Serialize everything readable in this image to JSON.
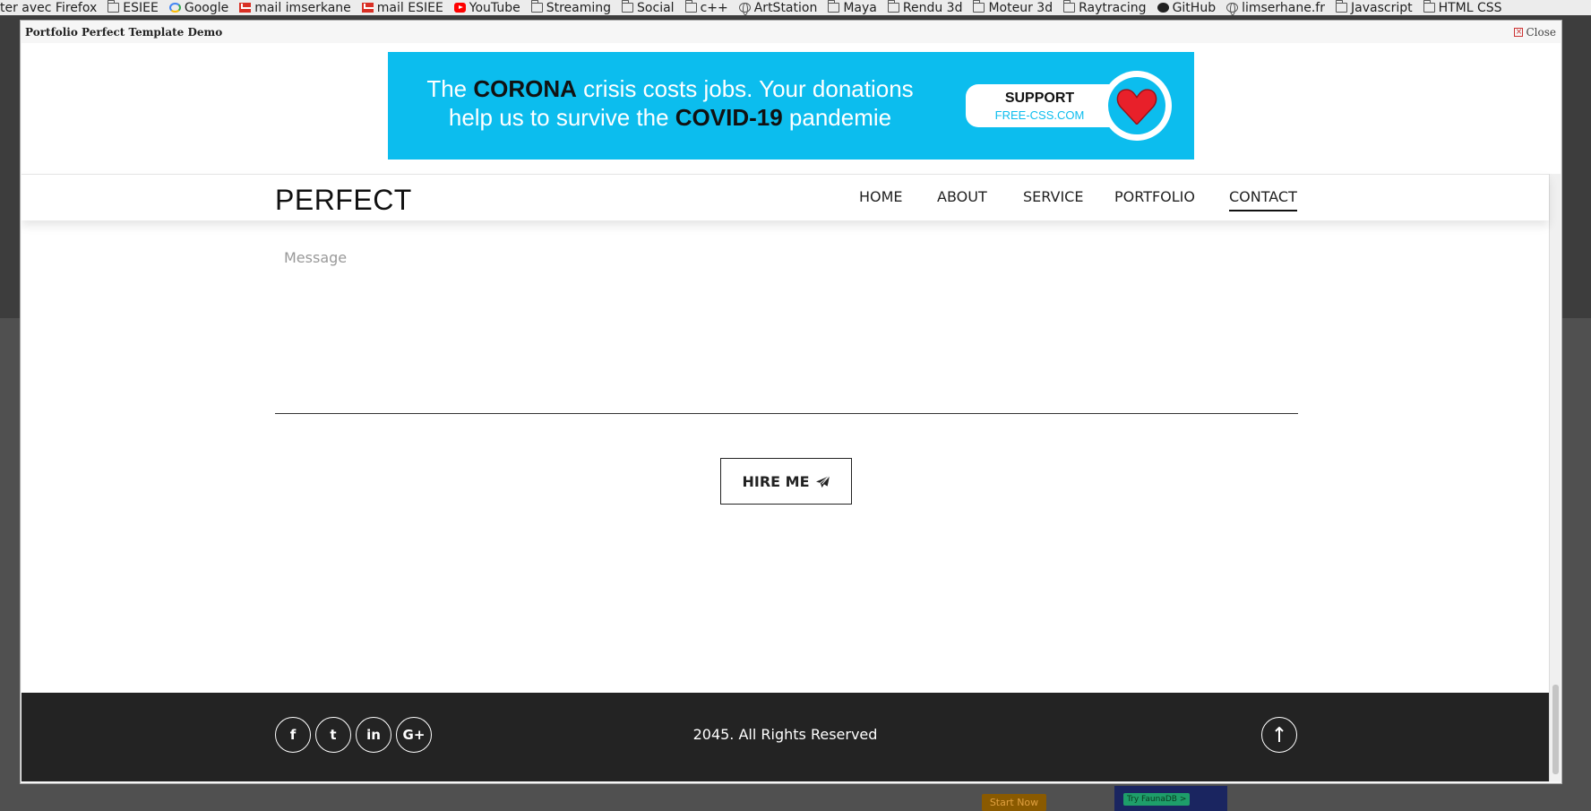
{
  "bookmarks": [
    {
      "label": "ter avec Firefox",
      "icon": "none"
    },
    {
      "label": "ESIEE",
      "icon": "folder-icon"
    },
    {
      "label": "Google",
      "icon": "google-icon"
    },
    {
      "label": "mail imserkane",
      "icon": "gmail-icon"
    },
    {
      "label": "mail ESIEE",
      "icon": "gmail-icon"
    },
    {
      "label": "YouTube",
      "icon": "youtube-icon"
    },
    {
      "label": "Streaming",
      "icon": "folder-icon"
    },
    {
      "label": "Social",
      "icon": "folder-icon"
    },
    {
      "label": "c++",
      "icon": "folder-icon"
    },
    {
      "label": "ArtStation",
      "icon": "globe-icon"
    },
    {
      "label": "Maya",
      "icon": "folder-icon"
    },
    {
      "label": "Rendu 3d",
      "icon": "folder-icon"
    },
    {
      "label": "Moteur 3d",
      "icon": "folder-icon"
    },
    {
      "label": "Raytracing",
      "icon": "folder-icon"
    },
    {
      "label": "GitHub",
      "icon": "github-icon"
    },
    {
      "label": "limserhane.fr",
      "icon": "globe-icon"
    },
    {
      "label": "Javascript",
      "icon": "folder-icon"
    },
    {
      "label": "HTML CSS",
      "icon": "folder-icon"
    }
  ],
  "modal": {
    "title": "Portfolio Perfect Template Demo",
    "close_label": "Close"
  },
  "banner": {
    "line1_pre": "The ",
    "line1_bold": "CORONA",
    "line1_post": " crisis costs jobs. Your donations",
    "line2_pre": "help us to survive the ",
    "line2_bold": "COVID-19",
    "line2_post": " pandemie",
    "support_title": "SUPPORT",
    "support_site": "FREE-CSS.COM",
    "colors": {
      "background": "#0cbdee",
      "heart": "#e8202a"
    }
  },
  "nav": {
    "logo": "PERFECT",
    "items": [
      "HOME",
      "ABOUT",
      "SERVICE",
      "PORTFOLIO",
      "CONTACT"
    ],
    "active": "CONTACT"
  },
  "form": {
    "message_placeholder": "Message",
    "message_value": "",
    "submit_label": "HIRE ME",
    "submit_icon": "paper-plane-icon"
  },
  "footer": {
    "social": [
      {
        "name": "facebook",
        "glyph": "f"
      },
      {
        "name": "twitter",
        "glyph": "t"
      },
      {
        "name": "linkedin",
        "glyph": "in"
      },
      {
        "name": "google-plus",
        "glyph": "G+"
      }
    ],
    "copyright": "2045. All Rights Reserved",
    "to_top_icon": "arrow-up-icon"
  },
  "background_page": {
    "button_label": "Start Now",
    "ad_label": "Try FaunaDB >"
  }
}
